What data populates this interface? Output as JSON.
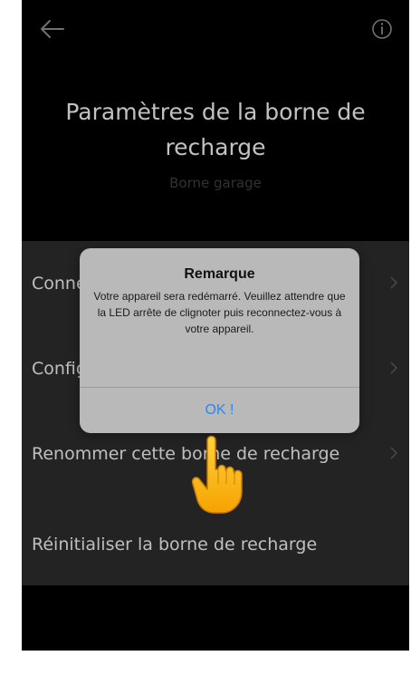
{
  "header": {
    "title": "Paramètres de la borne de recharge",
    "subtitle": "Borne garage"
  },
  "menu": {
    "items": [
      {
        "label": "Connecter la borne de recharge"
      },
      {
        "label": "Configurer la borne de recharge"
      },
      {
        "label": "Renommer cette borne de recharge"
      },
      {
        "label": "Réinitialiser la borne de recharge"
      }
    ]
  },
  "alert": {
    "title": "Remarque",
    "message": "Votre appareil sera redémarré. Veuillez attendre que la LED arrête de clignoter puis reconnectez-vous à votre appareil.",
    "button": "OK !"
  },
  "icons": {
    "back": "arrow-left-icon",
    "info": "info-circle-icon",
    "pointer": "pointing-hand-icon"
  },
  "colors": {
    "background": "#000000",
    "menu_background": "#2b2b2b",
    "alert_background": "#b9b9b9",
    "accent": "#2f86e8"
  }
}
